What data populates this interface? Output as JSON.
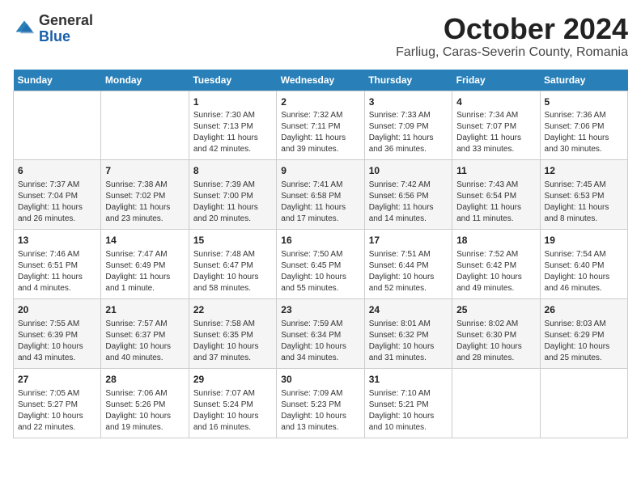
{
  "header": {
    "logo_general": "General",
    "logo_blue": "Blue",
    "title": "October 2024",
    "subtitle": "Farliug, Caras-Severin County, Romania"
  },
  "days_of_week": [
    "Sunday",
    "Monday",
    "Tuesday",
    "Wednesday",
    "Thursday",
    "Friday",
    "Saturday"
  ],
  "weeks": [
    [
      {
        "day": "",
        "info": ""
      },
      {
        "day": "",
        "info": ""
      },
      {
        "day": "1",
        "info": "Sunrise: 7:30 AM\nSunset: 7:13 PM\nDaylight: 11 hours and 42 minutes."
      },
      {
        "day": "2",
        "info": "Sunrise: 7:32 AM\nSunset: 7:11 PM\nDaylight: 11 hours and 39 minutes."
      },
      {
        "day": "3",
        "info": "Sunrise: 7:33 AM\nSunset: 7:09 PM\nDaylight: 11 hours and 36 minutes."
      },
      {
        "day": "4",
        "info": "Sunrise: 7:34 AM\nSunset: 7:07 PM\nDaylight: 11 hours and 33 minutes."
      },
      {
        "day": "5",
        "info": "Sunrise: 7:36 AM\nSunset: 7:06 PM\nDaylight: 11 hours and 30 minutes."
      }
    ],
    [
      {
        "day": "6",
        "info": "Sunrise: 7:37 AM\nSunset: 7:04 PM\nDaylight: 11 hours and 26 minutes."
      },
      {
        "day": "7",
        "info": "Sunrise: 7:38 AM\nSunset: 7:02 PM\nDaylight: 11 hours and 23 minutes."
      },
      {
        "day": "8",
        "info": "Sunrise: 7:39 AM\nSunset: 7:00 PM\nDaylight: 11 hours and 20 minutes."
      },
      {
        "day": "9",
        "info": "Sunrise: 7:41 AM\nSunset: 6:58 PM\nDaylight: 11 hours and 17 minutes."
      },
      {
        "day": "10",
        "info": "Sunrise: 7:42 AM\nSunset: 6:56 PM\nDaylight: 11 hours and 14 minutes."
      },
      {
        "day": "11",
        "info": "Sunrise: 7:43 AM\nSunset: 6:54 PM\nDaylight: 11 hours and 11 minutes."
      },
      {
        "day": "12",
        "info": "Sunrise: 7:45 AM\nSunset: 6:53 PM\nDaylight: 11 hours and 8 minutes."
      }
    ],
    [
      {
        "day": "13",
        "info": "Sunrise: 7:46 AM\nSunset: 6:51 PM\nDaylight: 11 hours and 4 minutes."
      },
      {
        "day": "14",
        "info": "Sunrise: 7:47 AM\nSunset: 6:49 PM\nDaylight: 11 hours and 1 minute."
      },
      {
        "day": "15",
        "info": "Sunrise: 7:48 AM\nSunset: 6:47 PM\nDaylight: 10 hours and 58 minutes."
      },
      {
        "day": "16",
        "info": "Sunrise: 7:50 AM\nSunset: 6:45 PM\nDaylight: 10 hours and 55 minutes."
      },
      {
        "day": "17",
        "info": "Sunrise: 7:51 AM\nSunset: 6:44 PM\nDaylight: 10 hours and 52 minutes."
      },
      {
        "day": "18",
        "info": "Sunrise: 7:52 AM\nSunset: 6:42 PM\nDaylight: 10 hours and 49 minutes."
      },
      {
        "day": "19",
        "info": "Sunrise: 7:54 AM\nSunset: 6:40 PM\nDaylight: 10 hours and 46 minutes."
      }
    ],
    [
      {
        "day": "20",
        "info": "Sunrise: 7:55 AM\nSunset: 6:39 PM\nDaylight: 10 hours and 43 minutes."
      },
      {
        "day": "21",
        "info": "Sunrise: 7:57 AM\nSunset: 6:37 PM\nDaylight: 10 hours and 40 minutes."
      },
      {
        "day": "22",
        "info": "Sunrise: 7:58 AM\nSunset: 6:35 PM\nDaylight: 10 hours and 37 minutes."
      },
      {
        "day": "23",
        "info": "Sunrise: 7:59 AM\nSunset: 6:34 PM\nDaylight: 10 hours and 34 minutes."
      },
      {
        "day": "24",
        "info": "Sunrise: 8:01 AM\nSunset: 6:32 PM\nDaylight: 10 hours and 31 minutes."
      },
      {
        "day": "25",
        "info": "Sunrise: 8:02 AM\nSunset: 6:30 PM\nDaylight: 10 hours and 28 minutes."
      },
      {
        "day": "26",
        "info": "Sunrise: 8:03 AM\nSunset: 6:29 PM\nDaylight: 10 hours and 25 minutes."
      }
    ],
    [
      {
        "day": "27",
        "info": "Sunrise: 7:05 AM\nSunset: 5:27 PM\nDaylight: 10 hours and 22 minutes."
      },
      {
        "day": "28",
        "info": "Sunrise: 7:06 AM\nSunset: 5:26 PM\nDaylight: 10 hours and 19 minutes."
      },
      {
        "day": "29",
        "info": "Sunrise: 7:07 AM\nSunset: 5:24 PM\nDaylight: 10 hours and 16 minutes."
      },
      {
        "day": "30",
        "info": "Sunrise: 7:09 AM\nSunset: 5:23 PM\nDaylight: 10 hours and 13 minutes."
      },
      {
        "day": "31",
        "info": "Sunrise: 7:10 AM\nSunset: 5:21 PM\nDaylight: 10 hours and 10 minutes."
      },
      {
        "day": "",
        "info": ""
      },
      {
        "day": "",
        "info": ""
      }
    ]
  ]
}
